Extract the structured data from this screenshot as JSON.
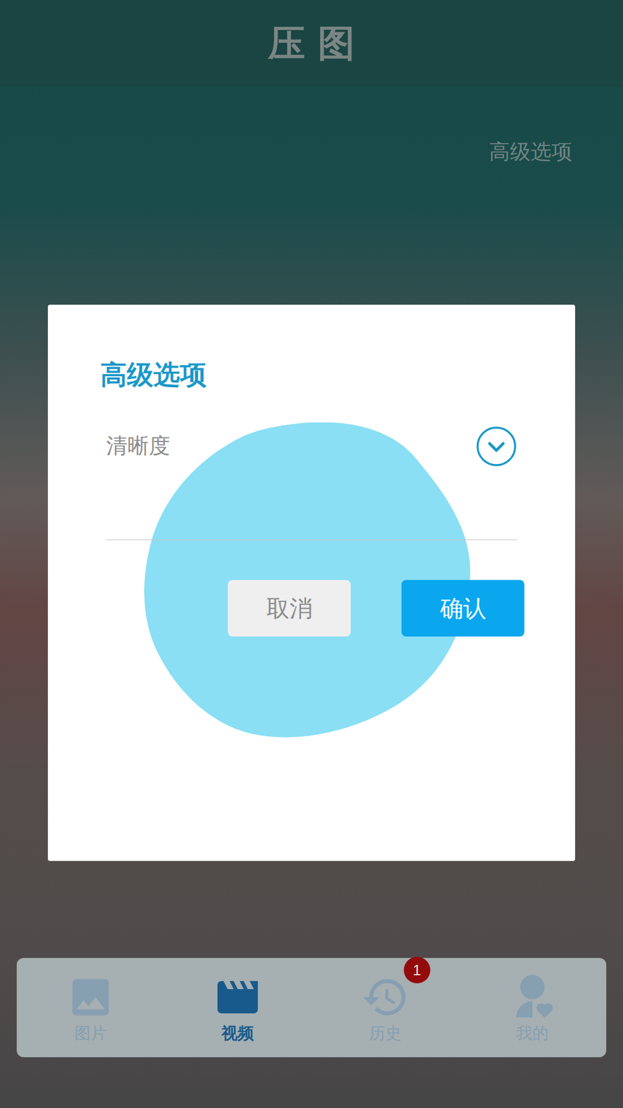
{
  "app_bar": {
    "title": "压图"
  },
  "link": "高级选项",
  "dialog": {
    "title": "高级选项",
    "field": {
      "label": "清晰度",
      "expanded": false
    },
    "buttons": [
      {
        "label": "取消",
        "primary": false
      },
      {
        "label": "确认",
        "primary": true
      }
    ]
  },
  "nav": [
    {
      "label": "图片",
      "selected": false,
      "badge": ""
    },
    {
      "label": "视频",
      "selected": true,
      "badge": ""
    },
    {
      "label": "历史",
      "selected": false,
      "badge": "1"
    },
    {
      "label": "我的",
      "selected": false,
      "badge": ""
    }
  ]
}
